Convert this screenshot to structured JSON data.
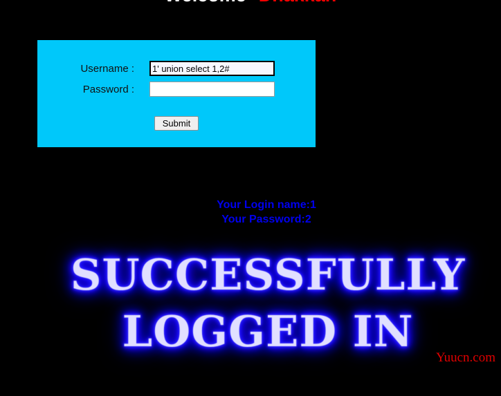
{
  "page": {
    "background_color": "#000000",
    "title": "Welcome Dhakkan"
  },
  "header": {
    "welcome_text": "Welcome",
    "brand_text": "Dhakkan",
    "welcome_color": "#ffffff",
    "brand_color": "#ff0000"
  },
  "login_form": {
    "panel_color": "#00c8fa",
    "username": {
      "label": "Username :",
      "value": "1' union select 1,2#",
      "placeholder": "",
      "focused": true
    },
    "password": {
      "label": "Password :",
      "value": "",
      "placeholder": "",
      "focused": false
    },
    "submit_label": "Submit"
  },
  "result": {
    "login_name_line": "Your Login name:1",
    "password_line": "Your Password:2",
    "text_color": "#0000ee"
  },
  "flag": {
    "line1": "SUCCESSFULLY",
    "line2": "LOGGED IN",
    "fill_color": "#b4b4b4",
    "glow_color": "#1a0aff"
  },
  "watermark": {
    "text": "Yuucn.com",
    "color": "#e00000"
  }
}
